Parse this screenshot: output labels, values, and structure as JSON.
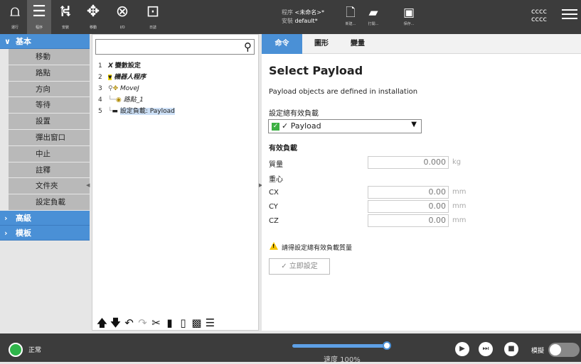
{
  "topbar": {
    "tabs": [
      {
        "label": "運行",
        "icon": "ur-logo-icon"
      },
      {
        "label": "程序",
        "icon": "program-icon"
      },
      {
        "label": "安裝",
        "icon": "install-icon"
      },
      {
        "label": "移動",
        "icon": "move-icon"
      },
      {
        "label": "I/O",
        "icon": "io-icon"
      },
      {
        "label": "日誌",
        "icon": "log-icon"
      }
    ],
    "program_prefix": "程序",
    "program_name": "<未命名>*",
    "install_prefix": "安裝",
    "install_name": "default*",
    "file_buttons": [
      {
        "label": "新建...",
        "icon": "new-file-icon"
      },
      {
        "label": "打開...",
        "icon": "open-folder-icon"
      },
      {
        "label": "保存...",
        "icon": "save-icon"
      }
    ],
    "user_line1": "cccc",
    "user_line2": "cccc"
  },
  "sidebar": {
    "category_basic": "基本",
    "items": [
      "移動",
      "路點",
      "方向",
      "等待",
      "設置",
      "彈出窗口",
      "中止",
      "註釋",
      "文件夾",
      "設定負載"
    ],
    "category_advanced": "高級",
    "category_templates": "模板"
  },
  "tree": {
    "search_placeholder": "",
    "rows": [
      {
        "num": "1",
        "glyph": "X",
        "text": "變數設定"
      },
      {
        "num": "2",
        "glyph": "▼",
        "text": "機器人程序"
      },
      {
        "num": "3",
        "glyph": "✥",
        "text": "MoveJ"
      },
      {
        "num": "4",
        "glyph": "◉",
        "text": "路點_1"
      },
      {
        "num": "5",
        "glyph": "▬",
        "text": "設定負載: Payload"
      }
    ]
  },
  "panel": {
    "tabs": [
      "命令",
      "圖形",
      "變量"
    ],
    "title": "Select Payload",
    "description": "Payload objects are defined in installation",
    "active_payload_label": "設定總有效負載",
    "payload_selected": "✓ Payload",
    "payload_section": "有效負載",
    "mass_label": "質量",
    "mass_value": "0.000",
    "mass_unit": "kg",
    "cog_label": "重心",
    "cx_label": "CX",
    "cx_value": "0.00",
    "cy_label": "CY",
    "cy_value": "0.00",
    "cz_label": "CZ",
    "cz_value": "0.00",
    "length_unit": "mm",
    "warning_text": "請得設定總有效負載質量",
    "set_now_label": "✓ 立即設定"
  },
  "bottombar": {
    "status": "正常",
    "speed_label": "速度 100%",
    "speed_fraction": 1.0,
    "sim_label": "模擬"
  },
  "colors": {
    "accent": "#4a90d6",
    "topbar": "#3c3c3c",
    "ok_green": "#2fb54a",
    "warning": "#f5c400"
  }
}
